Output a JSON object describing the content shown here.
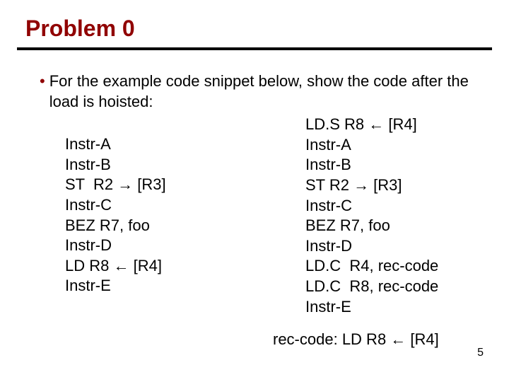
{
  "title": "Problem 0",
  "bullet": "For the example code snippet below, show the code after the load is hoisted:",
  "left_code": "Instr-A\nInstr-B\nST  R2 → [R3]\nInstr-C\nBEZ R7, foo\nInstr-D\nLD R8 ← [R4]\nInstr-E",
  "right_code": "LD.S R8 ← [R4]\nInstr-A\nInstr-B\nST R2 → [R3]\nInstr-C\nBEZ R7, foo\nInstr-D\nLD.C  R4, rec-code\nLD.C  R8, rec-code\nInstr-E",
  "rec_line": "rec-code: LD R8 ← [R4]",
  "page": "5"
}
